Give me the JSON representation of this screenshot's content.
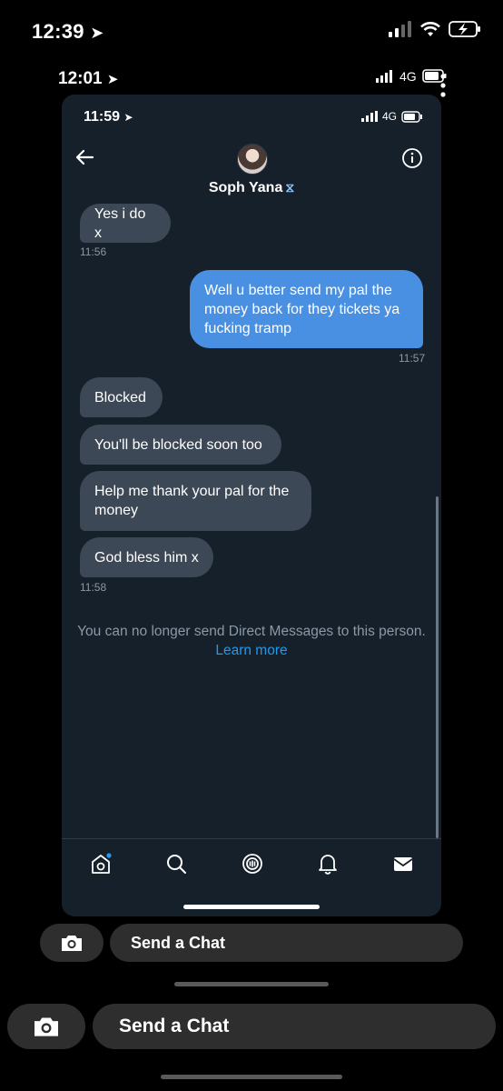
{
  "outer_status": {
    "time": "12:39"
  },
  "inner_status": {
    "time": "12:01",
    "network": "4G"
  },
  "twitter": {
    "status": {
      "time": "11:59",
      "network": "4G"
    },
    "contact_name": "Soph Yana",
    "messages": [
      {
        "text": "Yes i do x",
        "time": "11:56"
      },
      {
        "text": "Well u better send my pal the money back for they tickets ya fucking tramp",
        "time": "11:57"
      },
      {
        "text": "Blocked"
      },
      {
        "text": "You'll be blocked soon too"
      },
      {
        "text": "Help me thank your pal for the money"
      },
      {
        "text": "God bless him x",
        "time": "11:58"
      }
    ],
    "notice": "You can no longer send Direct Messages to this person.",
    "learn_more": "Learn more",
    "accent": "#1d9bf0"
  },
  "snap": {
    "chat_placeholder_1": "Send a Chat",
    "chat_placeholder_2": "Send a Chat"
  }
}
